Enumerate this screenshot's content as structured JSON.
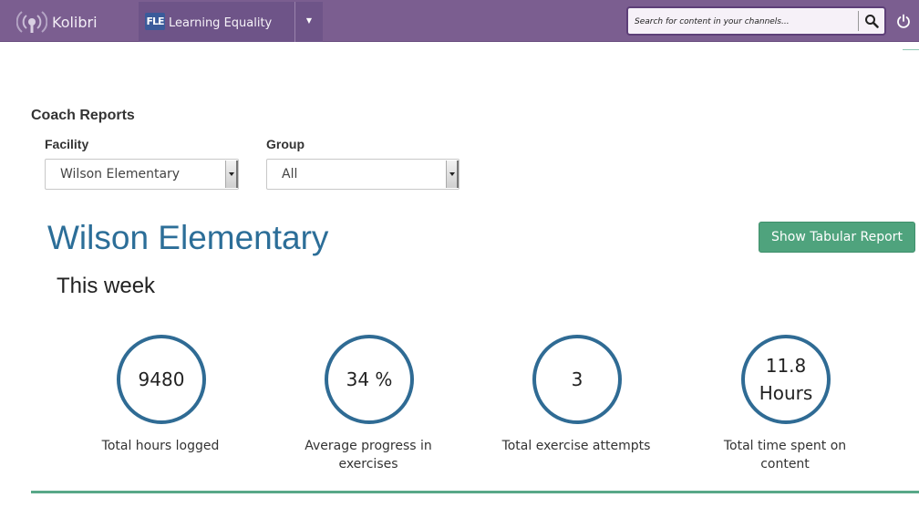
{
  "header": {
    "app_name": "Kolibri",
    "channel_icon_text": "FLE",
    "channel_name": "Learning Equality",
    "search_placeholder": "Search for content in your channels..."
  },
  "reports": {
    "title": "Coach Reports",
    "facility_label": "Facility",
    "facility_selected": "Wilson Elementary",
    "group_label": "Group",
    "group_selected": "All"
  },
  "summary": {
    "facility_heading": "Wilson Elementary",
    "tabular_button": "Show Tabular Report",
    "period": "This week",
    "stats": [
      {
        "value": "9480",
        "label": "Total hours logged"
      },
      {
        "value": "34 %",
        "label": "Average progress in exercises"
      },
      {
        "value": "3",
        "label": "Total exercise attempts"
      },
      {
        "value": "11.8 Hours",
        "label": "Total time spent on content"
      }
    ]
  },
  "colors": {
    "topbar": "#7b5e90",
    "accent_blue": "#2c6e98",
    "button_green": "#4fa37d"
  }
}
